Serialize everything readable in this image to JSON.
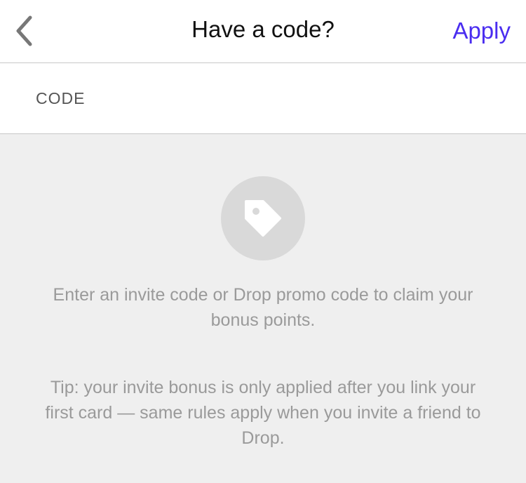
{
  "navbar": {
    "back_icon": "chevron-left-icon",
    "title": "Have a code?",
    "apply_label": "Apply",
    "accent_color": "#4a2df0"
  },
  "code_field": {
    "label": "CODE",
    "value": "",
    "placeholder": ""
  },
  "illustration": {
    "icon": "tag-icon"
  },
  "info": {
    "main_text": "Enter an invite code or Drop promo code to claim your bonus points.",
    "tip_text": "Tip: your invite bonus is only applied after you link your first card — same rules apply when you invite a friend to Drop."
  }
}
